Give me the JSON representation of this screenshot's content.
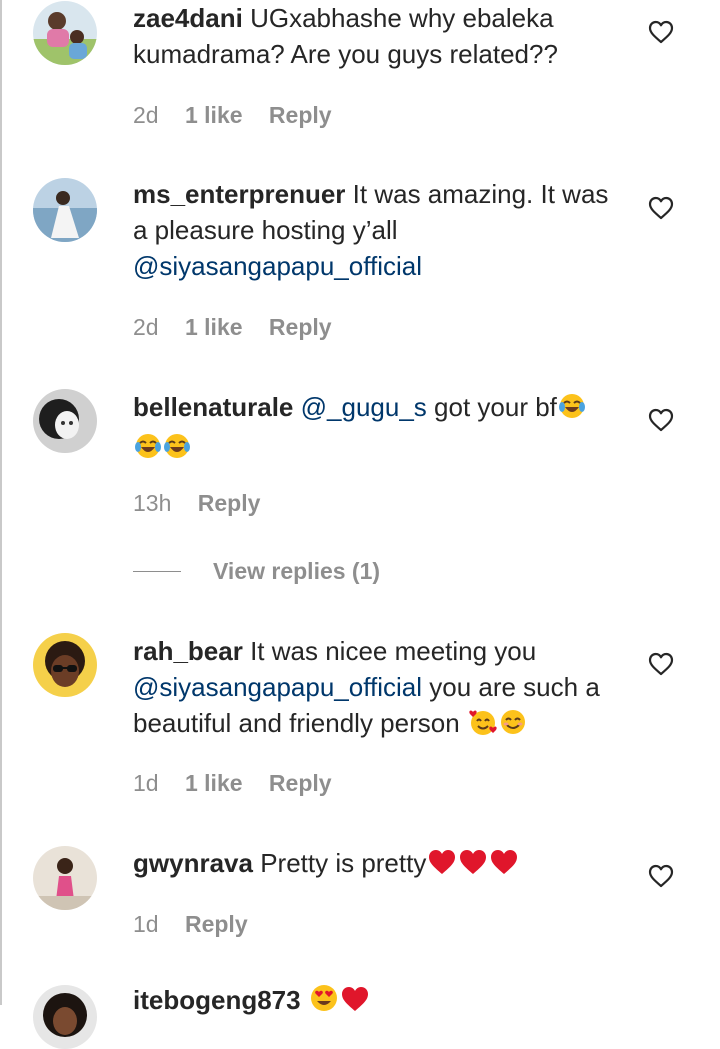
{
  "comments": [
    {
      "username": "zae4dani",
      "text_parts": [
        "UGxabhashe why ebaleka kumadrama? Are you guys related??"
      ],
      "time": "2d",
      "likes": "1 like",
      "reply": "Reply"
    },
    {
      "username": "ms_enterprenuer",
      "text_parts": [
        "It was amazing. It was a pleasure hosting y’all",
        "@siyasangapapu_official"
      ],
      "time": "2d",
      "likes": "1 like",
      "reply": "Reply"
    },
    {
      "username": "bellenaturale",
      "text_parts": [
        "@_gugu_s",
        "got your bf"
      ],
      "emojis": [
        "face-with-tears-of-joy",
        "face-with-tears-of-joy",
        "face-with-tears-of-joy"
      ],
      "time": "13h",
      "reply": "Reply",
      "view_replies": "View replies (1)"
    },
    {
      "username": "rah_bear",
      "text_parts": [
        "It was nicee meeting you",
        "@siyasangapapu_official",
        "you are such a beautiful and friendly person"
      ],
      "emojis": [
        "smiling-face-with-hearts",
        "smiling-face-with-smiling-eyes"
      ],
      "time": "1d",
      "likes": "1 like",
      "reply": "Reply"
    },
    {
      "username": "gwynrava",
      "text_parts": [
        "Pretty is pretty"
      ],
      "emojis": [
        "red-heart",
        "red-heart",
        "red-heart"
      ],
      "time": "1d",
      "reply": "Reply"
    },
    {
      "username": "itebogeng873",
      "emojis": [
        "smiling-face-with-heart-eyes",
        "red-heart"
      ]
    }
  ],
  "colors": {
    "text": "#262626",
    "secondary": "#8e8e8e",
    "mention": "#00376b",
    "heart_emoji": "#e0162b"
  }
}
